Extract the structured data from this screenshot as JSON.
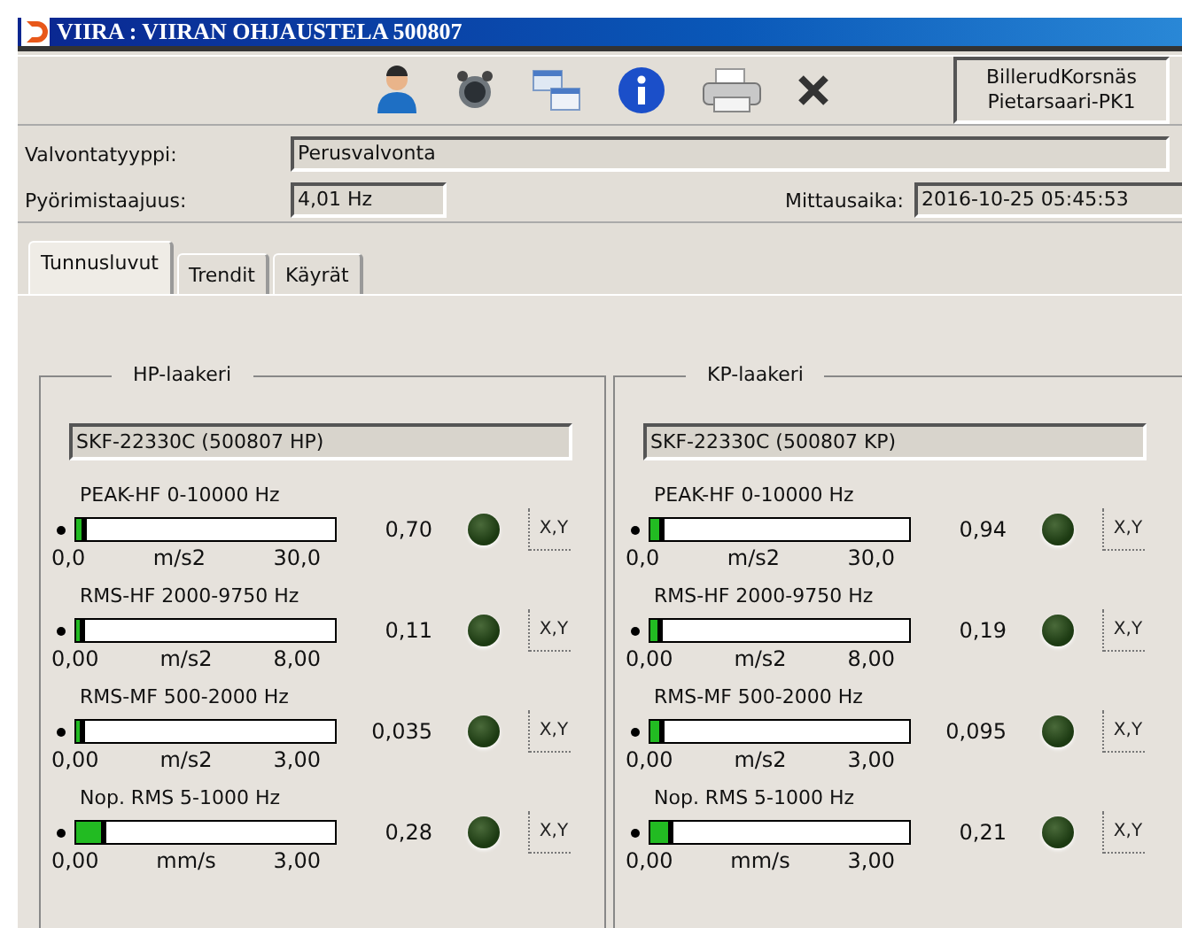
{
  "window": {
    "title": "VIIRA : VIIRAN  OHJAUSTELA 500807"
  },
  "toolbar": {
    "company": [
      "BillerudKorsnäs",
      "Pietarsaari-PK1"
    ]
  },
  "fields": [
    {
      "label": "Valvontatyyppi:",
      "value": "Perusvalvonta"
    },
    {
      "label": "Pyörimistaajuus:",
      "value": "4,01 Hz"
    }
  ],
  "measurement_time": {
    "label": "Mittausaika:",
    "value": "2016-10-25   05:45:53"
  },
  "tabs": [
    {
      "label": "Tunnusluvut",
      "selected": true
    },
    {
      "label": "Trendit",
      "selected": false
    },
    {
      "label": "Käyrät",
      "selected": false
    }
  ],
  "groups": [
    {
      "title": "HP-laakeri",
      "bearing": "SKF-22330C (500807 HP)",
      "meters": [
        {
          "name": "PEAK-HF 0-10000 Hz",
          "level": 0.023,
          "min": "0,0",
          "unit": "m/s2",
          "max": "30,0",
          "reading": "0,70",
          "chart_button": "X,Y"
        },
        {
          "name": "RMS-HF 2000-9750 Hz",
          "level": 0.014,
          "min": "0,00",
          "unit": "m/s2",
          "max": "8,00",
          "reading": "0,11",
          "chart_button": "X,Y"
        },
        {
          "name": "RMS-MF 500-2000 Hz",
          "level": 0.012,
          "min": "0,00",
          "unit": "m/s2",
          "max": "3,00",
          "reading": "0,035",
          "chart_button": "X,Y"
        },
        {
          "name": "Nop. RMS 5-1000 Hz",
          "level": 0.093,
          "min": "0,00",
          "unit": "mm/s",
          "max": "3,00",
          "reading": "0,28",
          "chart_button": "X,Y"
        }
      ]
    },
    {
      "title": "KP-laakeri",
      "bearing": "SKF-22330C (500807 KP)",
      "meters": [
        {
          "name": "PEAK-HF 0-10000 Hz",
          "level": 0.031,
          "min": "0,0",
          "unit": "m/s2",
          "max": "30,0",
          "reading": "0,94",
          "chart_button": "X,Y"
        },
        {
          "name": "RMS-HF 2000-9750 Hz",
          "level": 0.024,
          "min": "0,00",
          "unit": "m/s2",
          "max": "8,00",
          "reading": "0,19",
          "chart_button": "X,Y"
        },
        {
          "name": "RMS-MF 500-2000 Hz",
          "level": 0.032,
          "min": "0,00",
          "unit": "m/s2",
          "max": "3,00",
          "reading": "0,095",
          "chart_button": "X,Y"
        },
        {
          "name": "Nop. RMS 5-1000 Hz",
          "level": 0.07,
          "min": "0,00",
          "unit": "mm/s",
          "max": "3,00",
          "reading": "0,21",
          "chart_button": "X,Y"
        }
      ]
    }
  ]
}
